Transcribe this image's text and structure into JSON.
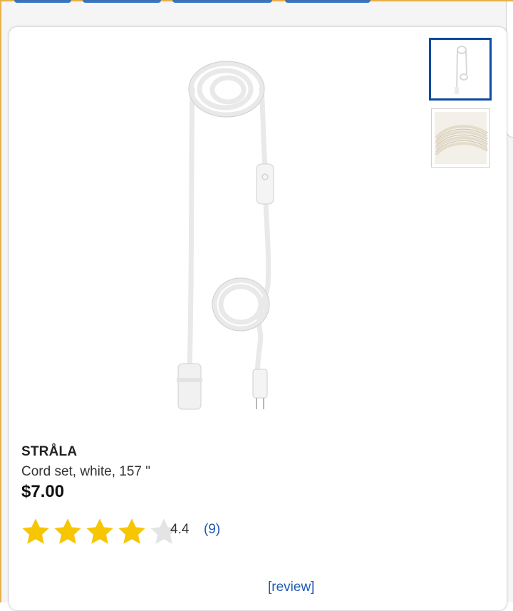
{
  "product": {
    "brand": "STRÅLA",
    "description": "Cord set, white, 157 \"",
    "price": "$7.00",
    "rating": {
      "value": "4.4",
      "count": "(9)",
      "stars_filled": 4,
      "stars_total": 5
    },
    "review_link": "[review]",
    "thumbnails": [
      {
        "icon": "cord-set-full-view",
        "selected": true
      },
      {
        "icon": "cord-coil-closeup",
        "selected": false
      }
    ]
  },
  "colors": {
    "accent_border": "#e8b04a",
    "selected_thumb_border": "#0e4a9e",
    "link": "#1e5ab4",
    "star_filled": "#f7c600",
    "star_empty": "#e4e4e4"
  }
}
